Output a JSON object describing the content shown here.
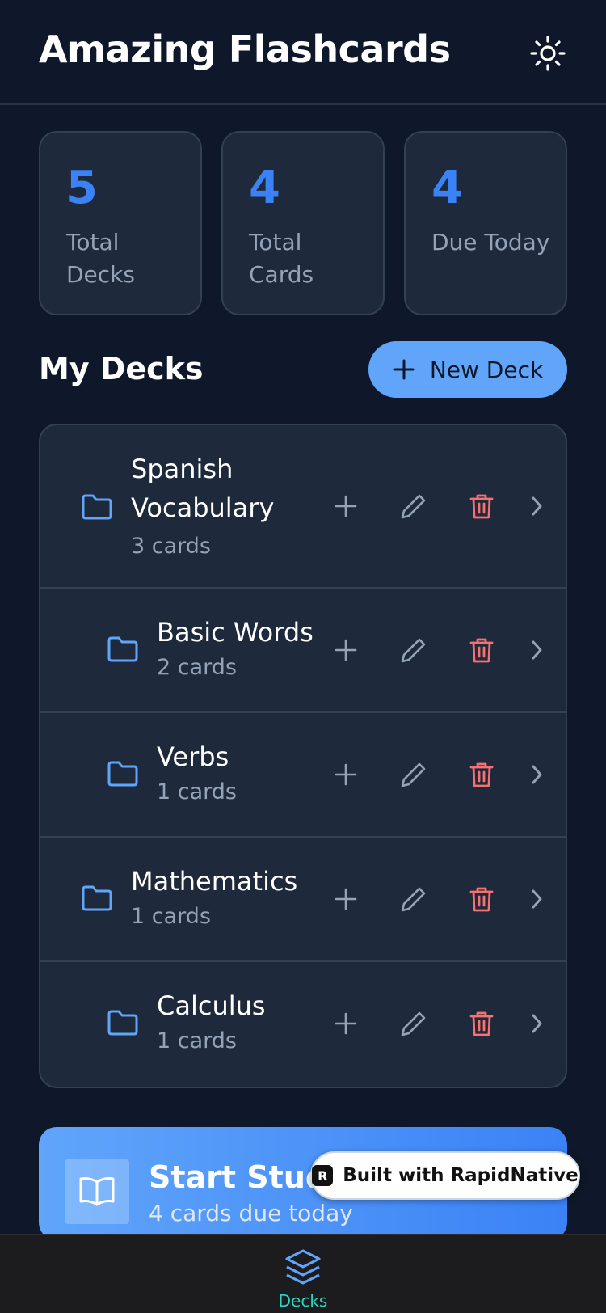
{
  "header": {
    "title": "Amazing Flashcards",
    "theme_icon": "sun-icon"
  },
  "stats": [
    {
      "value": "5",
      "label": "Total Decks"
    },
    {
      "value": "4",
      "label": "Total Cards"
    },
    {
      "value": "4",
      "label": "Due Today"
    }
  ],
  "decks_section": {
    "title": "My Decks",
    "new_deck_label": "New Deck"
  },
  "decks": [
    {
      "name": "Spanish Vocabulary",
      "count": "3 cards",
      "level": 0
    },
    {
      "name": "Basic Words",
      "count": "2 cards",
      "level": 1
    },
    {
      "name": "Verbs",
      "count": "1 cards",
      "level": 1
    },
    {
      "name": "Mathematics",
      "count": "1 cards",
      "level": 0
    },
    {
      "name": "Calculus",
      "count": "1 cards",
      "level": 1
    }
  ],
  "study": {
    "title": "Start Study",
    "subtitle": "4 cards due today",
    "icon": "book-open-icon"
  },
  "badge": {
    "label": "Built with RapidNative",
    "logo": "R"
  },
  "nav": {
    "tabs": [
      {
        "label": "Decks",
        "icon": "layers-icon",
        "active": true
      }
    ]
  },
  "colors": {
    "accent": "#3b82f6",
    "danger": "#f87171",
    "active_tab": "#2dd4bf"
  }
}
